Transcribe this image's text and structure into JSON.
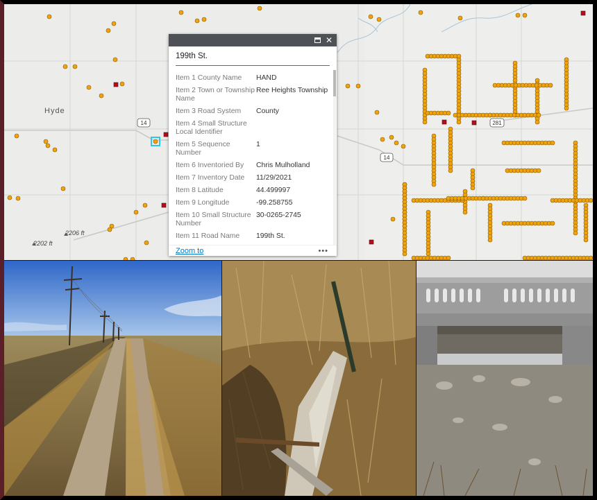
{
  "map": {
    "place_labels": {
      "hyde": "Hyde",
      "elev_1": "2206 ft",
      "elev_2": "2202 ft"
    },
    "route_shields": {
      "us14_a": "14",
      "us14_b": "14",
      "us281": "281"
    }
  },
  "popup": {
    "title": "199th St.",
    "fields": [
      {
        "key": "Item 1 County Name",
        "value": "HAND"
      },
      {
        "key": "Item 2 Town or Township Name",
        "value": "Ree Heights Township"
      },
      {
        "key": "Item 3 Road System",
        "value": "County"
      },
      {
        "key": "Item 4 Small Structure Local Identifier",
        "value": ""
      },
      {
        "key": "Item 5 Sequence Number",
        "value": "1"
      },
      {
        "key": "Item 6 Inventoried By",
        "value": "Chris Mulholland"
      },
      {
        "key": "Item 7 Inventory Date",
        "value": "11/29/2021"
      },
      {
        "key": "Item 8 Latitude",
        "value": "44.499997"
      },
      {
        "key": "Item 9 Longitude",
        "value": "-99.258755"
      },
      {
        "key": "Item 10 Small Structure Number",
        "value": "30-0265-2745"
      },
      {
        "key": "Item 11 Road Name",
        "value": "199th St."
      }
    ],
    "zoom_label": "Zoom to",
    "more_label": "•••",
    "close_label": "✕"
  },
  "colors": {
    "frame": "#5a1f28",
    "marker": "#f0a30a",
    "marker_red": "#b0101c",
    "popup_header": "#4e5256",
    "link": "#0079c1"
  }
}
